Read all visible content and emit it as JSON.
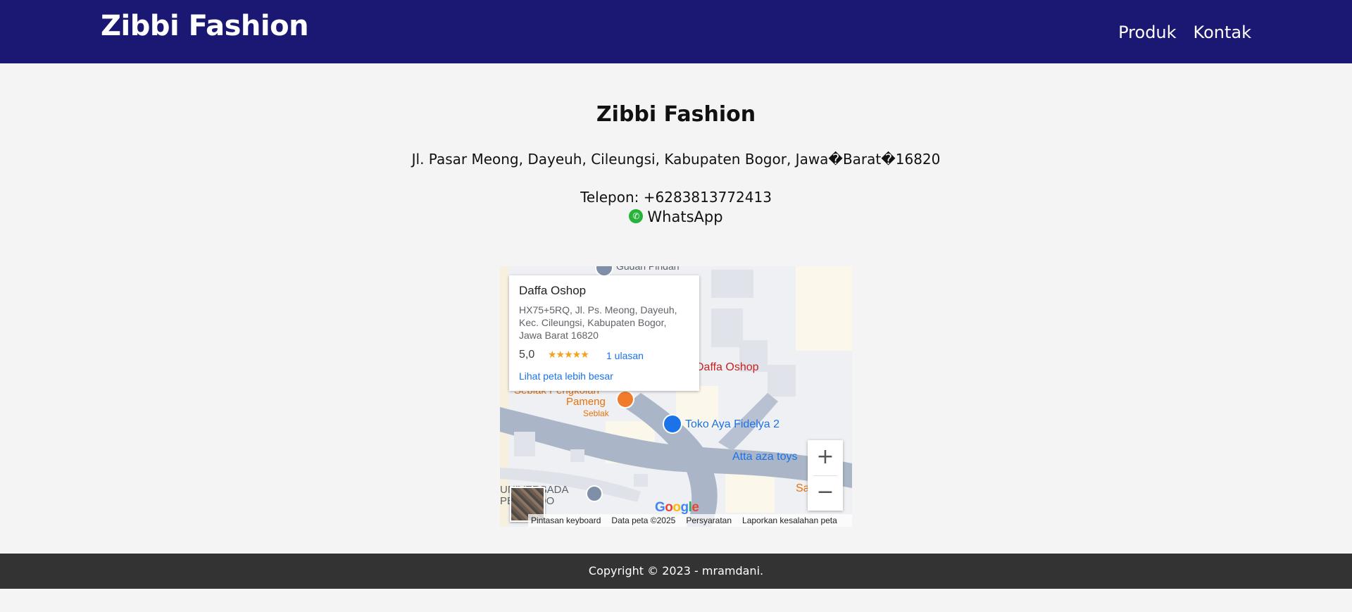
{
  "header": {
    "brand": "Zibbi Fashion",
    "nav": [
      {
        "label": "Produk"
      },
      {
        "label": "Kontak"
      }
    ]
  },
  "contact": {
    "title": "Zibbi Fashion",
    "address": "Jl. Pasar Meong, Dayeuh, Cileungsi, Kabupaten Bogor, Jawa�Barat�16820",
    "phone": "Telepon: +6283813772413",
    "whatsapp": "WhatsApp"
  },
  "map": {
    "info_card": {
      "name": "Daffa Oshop",
      "address": "HX75+5RQ, Jl. Ps. Meong, Dayeuh, Kec. Cileungsi, Kabupaten Bogor, Jawa Barat 16820",
      "rating": "5,0",
      "stars": "★★★★★",
      "reviews": "1 ulasan",
      "bigger_map": "Lihat peta lebih besar"
    },
    "pois": {
      "top": "Gudan Pindah",
      "daffa": "Daffa Oshop",
      "seblak": "Seblak Pengkolan",
      "pameng": "Pameng",
      "seblak_cat": "Seblak",
      "toko": "Toko Aya Fidelya 2",
      "atta": "Atta aza toys",
      "univ1": "UNIVERSADA",
      "univ2": "PERTINDO",
      "sa": "Sa"
    },
    "zoom_in": "+",
    "zoom_out": "−",
    "logo": "Google",
    "attribution": {
      "keyboard": "Pintasan keyboard",
      "data": "Data peta ©2025",
      "terms": "Persyaratan",
      "report": "Laporkan kesalahan peta"
    }
  },
  "footer": {
    "copyright": "Copyright © 2023 - mramdani."
  },
  "colors": {
    "header_bg": "#1a1872",
    "footer_bg": "#333333",
    "page_bg": "#f4f4f4",
    "link_blue": "#1a73e8",
    "whatsapp_green": "#25b33a"
  }
}
